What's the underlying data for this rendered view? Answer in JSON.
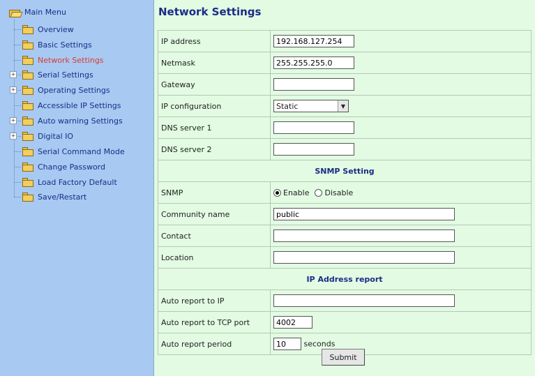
{
  "sidebar": {
    "root_label": "Main Menu",
    "items": [
      {
        "label": "Overview"
      },
      {
        "label": "Basic Settings"
      },
      {
        "label": "Network Settings"
      },
      {
        "label": "Serial Settings"
      },
      {
        "label": "Operating Settings"
      },
      {
        "label": "Accessible IP Settings"
      },
      {
        "label": "Auto warning Settings"
      },
      {
        "label": "Digital IO"
      },
      {
        "label": "Serial Command Mode"
      },
      {
        "label": "Change Password"
      },
      {
        "label": "Load Factory Default"
      },
      {
        "label": "Save/Restart"
      }
    ],
    "active_item": "Network Settings"
  },
  "page": {
    "title": "Network Settings"
  },
  "form": {
    "ip_address": {
      "label": "IP address",
      "value": "192.168.127.254"
    },
    "netmask": {
      "label": "Netmask",
      "value": "255.255.255.0"
    },
    "gateway": {
      "label": "Gateway",
      "value": ""
    },
    "ip_configuration": {
      "label": "IP configuration",
      "value": "Static"
    },
    "dns1": {
      "label": "DNS server 1",
      "value": ""
    },
    "dns2": {
      "label": "DNS server 2",
      "value": ""
    },
    "snmp_section": "SNMP Setting",
    "snmp": {
      "label": "SNMP",
      "enable_label": "Enable",
      "disable_label": "Disable",
      "selected": "Enable"
    },
    "community": {
      "label": "Community name",
      "value": "public"
    },
    "contact": {
      "label": "Contact",
      "value": ""
    },
    "location": {
      "label": "Location",
      "value": ""
    },
    "ip_report_section": "IP Address report",
    "auto_report_ip": {
      "label": "Auto report to IP",
      "value": ""
    },
    "auto_report_port": {
      "label": "Auto report to TCP port",
      "value": "4002"
    },
    "auto_report_period": {
      "label": "Auto report period",
      "value": "10",
      "unit": "seconds"
    },
    "submit_label": "Submit"
  },
  "colors": {
    "sidebar_bg": "#a7c9f2",
    "main_bg": "#e2fbe2",
    "link_blue": "#1b2c86",
    "active_red": "#e03a2f"
  },
  "icons": {
    "root": "open-folder-icon",
    "item": "folder-icon",
    "expand": "plus-expander-icon",
    "select_arrow": "dropdown-arrow-icon"
  }
}
